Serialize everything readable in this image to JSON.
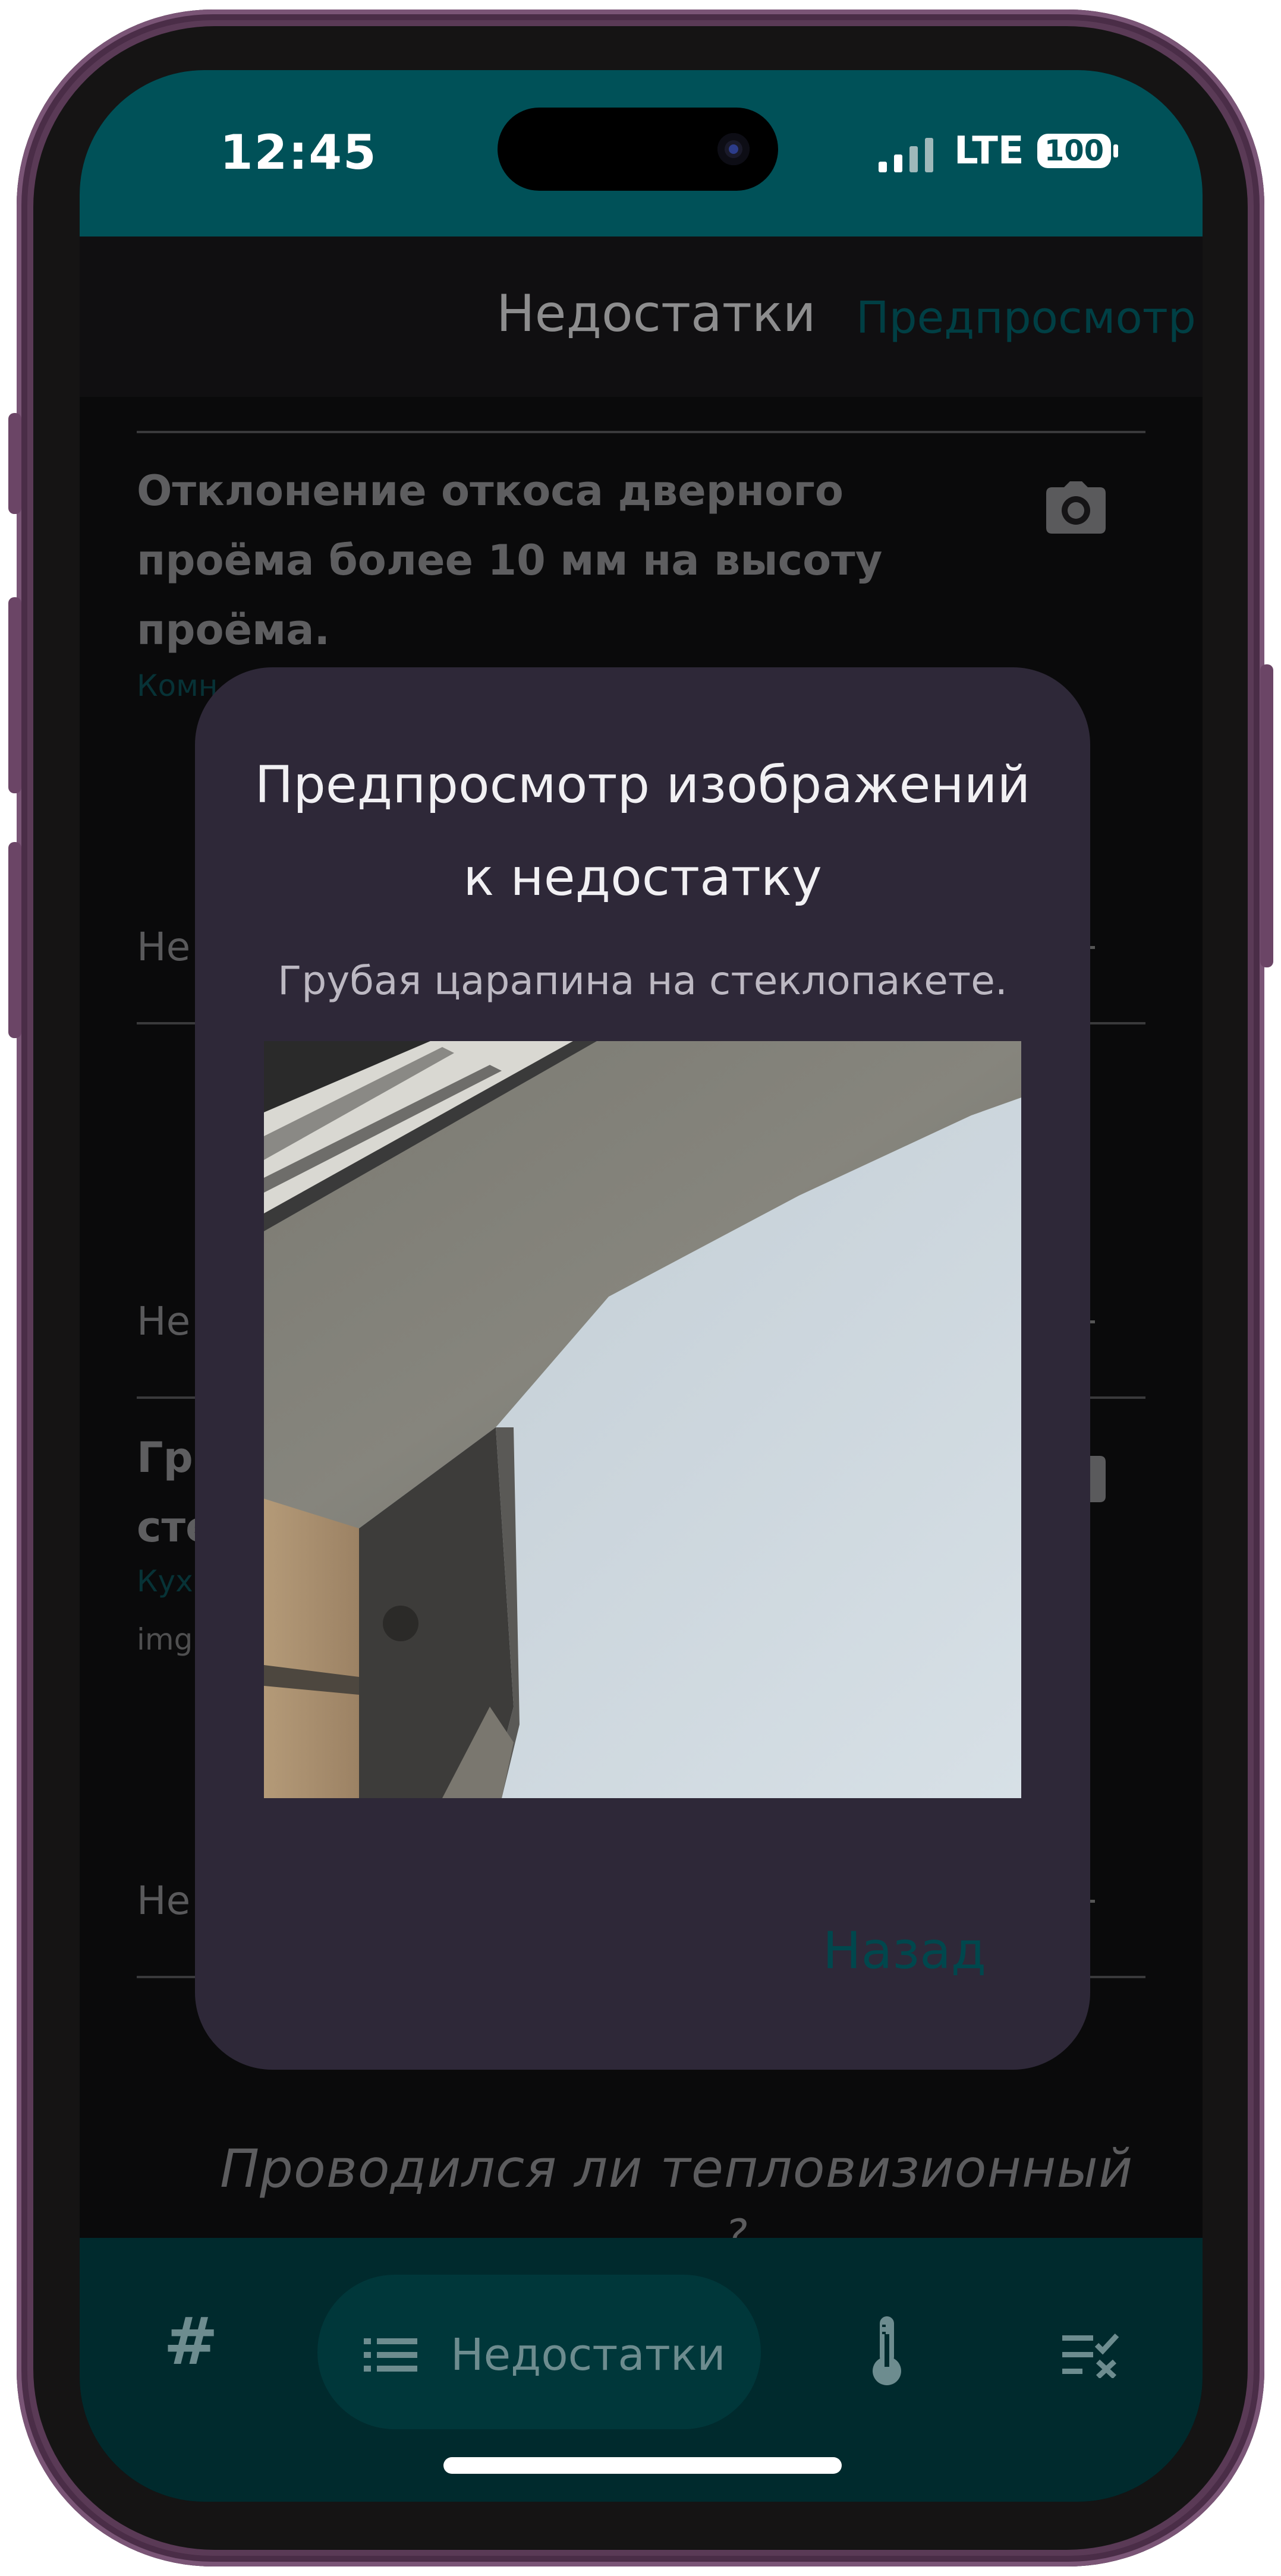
{
  "status_bar": {
    "time": "12:45",
    "network": "LTE",
    "battery": "100"
  },
  "header": {
    "title": "Недостатки",
    "preview_link": "Предпросмотр"
  },
  "list": {
    "item1": {
      "title": "Отклонение откоса дверного проёма более 10 мм на высоту проёма.",
      "location_partial": "Комн"
    },
    "row_partial_1": "Не",
    "row_partial_2": "Не",
    "item2": {
      "title_partial_line1": "Гр",
      "title_partial_line2": "сте",
      "location_partial": "Кух",
      "img_partial": "img"
    },
    "row_partial_3": "Не"
  },
  "question": {
    "line1": "Проводился ли тепловизионный",
    "line2_partial": "?"
  },
  "dialog": {
    "title_line1": "Предпросмотр изображений",
    "title_line2": "к недостатку",
    "subtitle": "Грубая царапина на стеклопакете.",
    "back_label": "Назад"
  },
  "bottom_nav": {
    "hash_symbol": "#",
    "active_label": "Недостатки",
    "icons": [
      "hash-icon",
      "list-icon",
      "thermometer-icon",
      "checklist-icon"
    ]
  },
  "colors": {
    "accent_teal": "#005158",
    "dialog_bg": "#2e2838",
    "phone_frame": "#5a3a56"
  }
}
